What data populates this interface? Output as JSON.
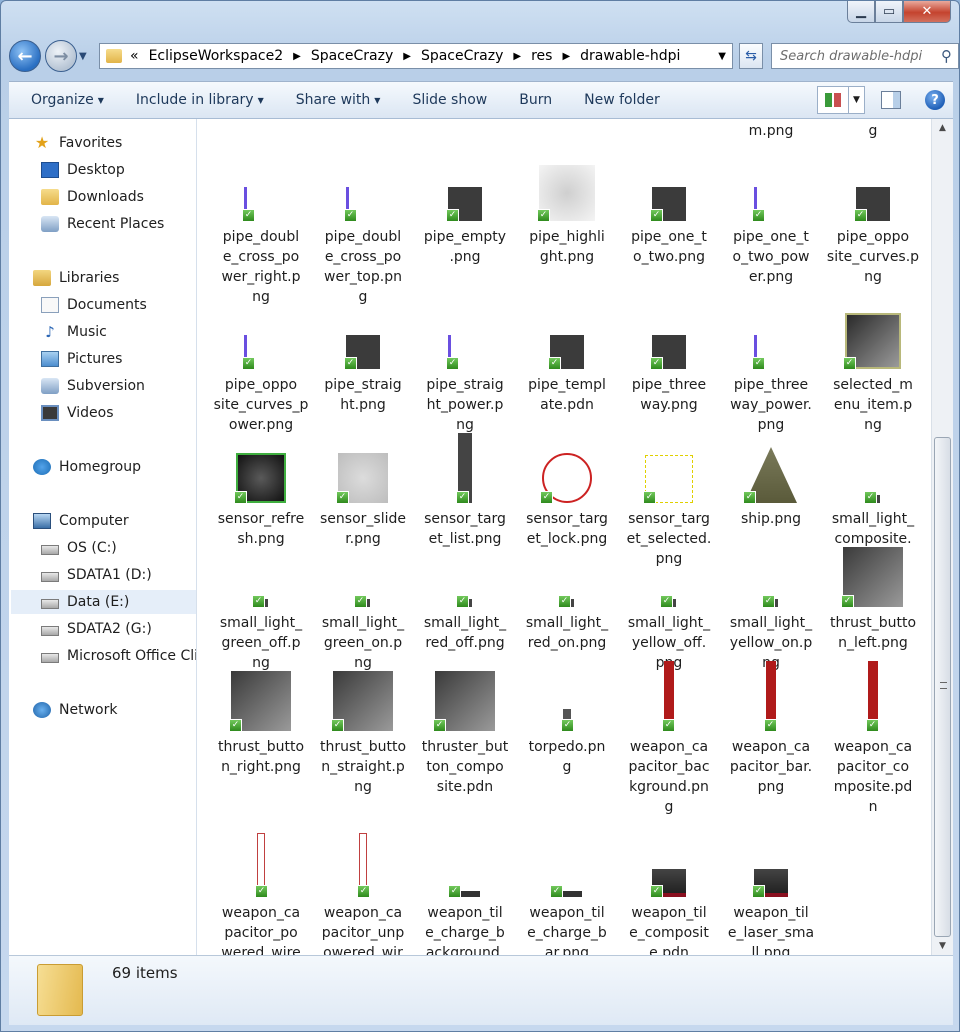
{
  "window": {
    "minimize_icon": "minimize-icon",
    "maximize_icon": "maximize-icon",
    "close_icon": "close-icon"
  },
  "nav": {
    "overflow": "«",
    "breadcrumbs": [
      "EclipseWorkspace2",
      "SpaceCrazy",
      "SpaceCrazy",
      "res",
      "drawable-hdpi"
    ],
    "search_placeholder": "Search drawable-hdpi"
  },
  "toolbar": {
    "buttons": [
      "Organize",
      "Include in library",
      "Share with",
      "Slide show",
      "Burn",
      "New folder"
    ]
  },
  "sidebar": {
    "favorites": {
      "label": "Favorites",
      "items": [
        "Desktop",
        "Downloads",
        "Recent Places"
      ]
    },
    "libraries": {
      "label": "Libraries",
      "items": [
        "Documents",
        "Music",
        "Pictures",
        "Subversion",
        "Videos"
      ]
    },
    "homegroup": "Homegroup",
    "computer": {
      "label": "Computer",
      "items": [
        "OS (C:)",
        "SDATA1 (D:)",
        "Data (E:)",
        "SDATA2 (G:)",
        "Microsoft Office Cli"
      ]
    },
    "network": "Network"
  },
  "files": [
    "g",
    "wer_botto\nm.png",
    "wer_left.pn\ng",
    "pipe_doubl\ne_cross_po\nwer_right.p\nng",
    "pipe_doubl\ne_cross_po\nwer_top.pn\ng",
    "pipe_empty\n.png",
    "pipe_highli\nght.png",
    "pipe_one_t\no_two.png",
    "pipe_one_t\no_two_pow\ner.png",
    "pipe_oppo\nsite_curves.p\nng",
    "pipe_oppo\nsite_curves_p\nower.png",
    "pipe_straig\nht.png",
    "pipe_straig\nht_power.p\nng",
    "pipe_templ\nate.pdn",
    "pipe_three\nway.png",
    "pipe_three\nway_power.\npng",
    "selected_m\nenu_item.p\nng",
    "sensor_refre\nsh.png",
    "sensor_slide\nr.png",
    "sensor_targ\net_list.png",
    "sensor_targ\net_lock.png",
    "sensor_targ\net_selected.\npng",
    "ship.png",
    "small_light_\ncomposite.\npdn",
    "small_light_\ngreen_off.p\nng",
    "small_light_\ngreen_on.p\nng",
    "small_light_\nred_off.png",
    "small_light_\nred_on.png",
    "small_light_\nyellow_off.\npng",
    "small_light_\nyellow_on.p\nng",
    "thrust_butto\nn_left.png",
    "thrust_butto\nn_right.png",
    "thrust_butto\nn_straight.p\nng",
    "thruster_but\nton_compo\nsite.pdn",
    "torpedo.pn\ng",
    "weapon_ca\npacitor_bac\nkground.pn\ng",
    "weapon_ca\npacitor_bar.\npng",
    "weapon_ca\npacitor_co\nmposite.pd\nn",
    "weapon_ca\npacitor_po\nwered_wire\ns.png",
    "weapon_ca\npacitor_unp\nowered_wir\nes.png",
    "weapon_til\ne_charge_b\nackground.\npng",
    "weapon_til\ne_charge_b\nar.png",
    "weapon_til\ne_composit\ne.pdn",
    "weapon_til\ne_laser_sma\nll.png"
  ],
  "status": {
    "count": "69 items"
  },
  "colors": {
    "accent": "#2a6fc2",
    "check": "#3fa02a"
  }
}
